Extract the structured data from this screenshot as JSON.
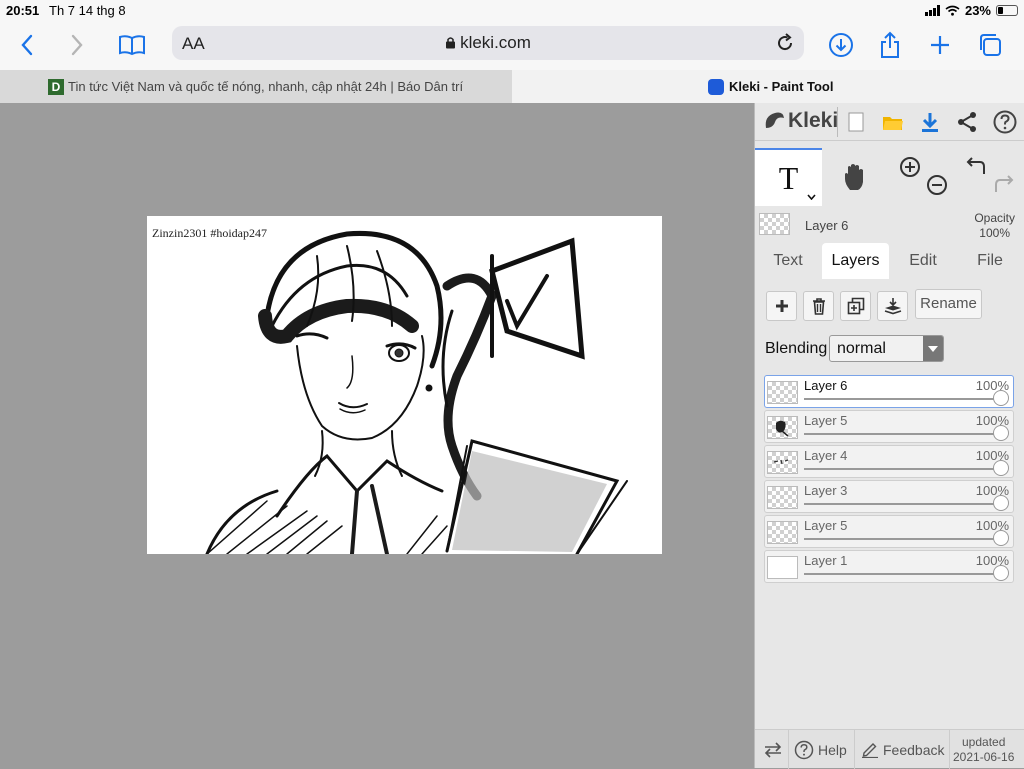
{
  "status": {
    "time": "20:51",
    "date": "Th 7 14 thg 8",
    "battery": "23%"
  },
  "browser": {
    "url_aa": "AA",
    "domain": "kleki.com",
    "tabs": [
      {
        "favicon": "D",
        "title": "Tin tức Việt Nam và quốc tế nóng, nhanh, cập nhật 24h | Báo Dân trí"
      },
      {
        "title": "Kleki - Paint Tool"
      }
    ]
  },
  "canvas": {
    "signature": "Zinzin2301  #hoidap247"
  },
  "panel": {
    "brand": "Kleki",
    "current_layer": "Layer 6",
    "opacity_label": "Opacity",
    "opacity_value": "100%",
    "tabs": [
      "Text",
      "Layers",
      "Edit",
      "File"
    ],
    "active_tab": "Layers",
    "rename_label": "Rename",
    "blending_label": "Blending",
    "blending_value": "normal",
    "layers": [
      {
        "name": "Layer 6",
        "opacity": "100%",
        "selected": true
      },
      {
        "name": "Layer 5",
        "opacity": "100%"
      },
      {
        "name": "Layer 4",
        "opacity": "100%"
      },
      {
        "name": "Layer 3",
        "opacity": "100%"
      },
      {
        "name": "Layer 5",
        "opacity": "100%"
      },
      {
        "name": "Layer 1",
        "opacity": "100%"
      }
    ],
    "footer": {
      "help": "Help",
      "feedback": "Feedback",
      "updated_label": "updated",
      "updated_date": "2021-06-16"
    }
  }
}
